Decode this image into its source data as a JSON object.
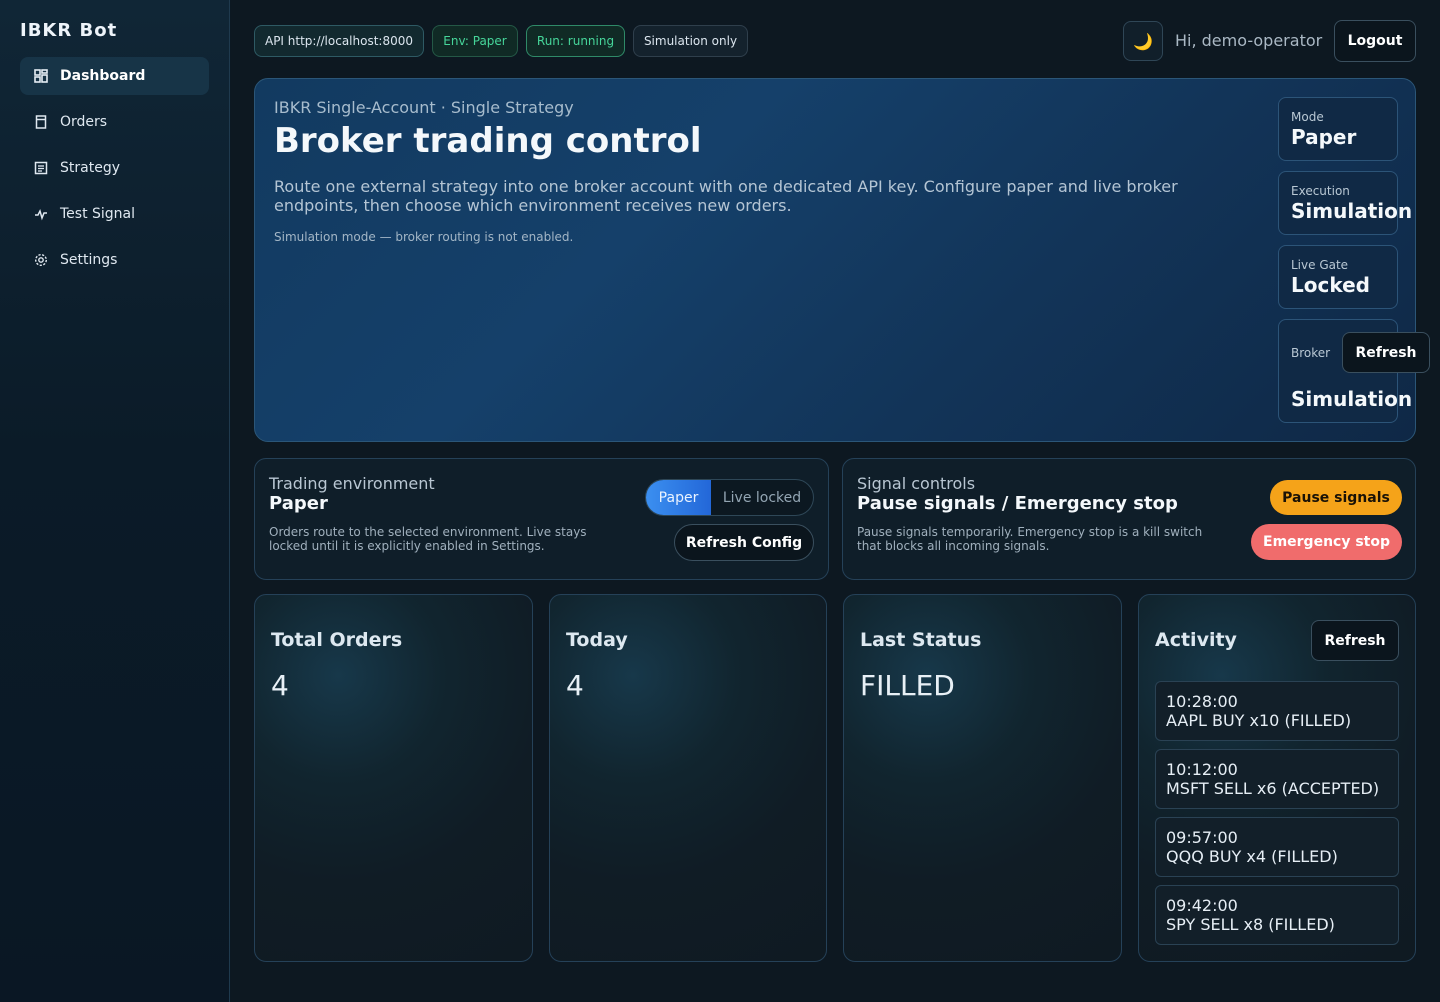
{
  "sidebar": {
    "brand": "IBKR Bot",
    "items": [
      {
        "label": "Dashboard",
        "icon": "dashboard-icon",
        "active": true
      },
      {
        "label": "Orders",
        "icon": "orders-icon"
      },
      {
        "label": "Strategy",
        "icon": "strategy-icon"
      },
      {
        "label": "Test Signal",
        "icon": "signal-icon"
      },
      {
        "label": "Settings",
        "icon": "gear-icon"
      }
    ]
  },
  "header": {
    "api_badge": "API http://localhost:8000",
    "env_badge": "Env: Paper",
    "run_badge": "Run: running",
    "sim_badge": "Simulation only",
    "theme_icon": "moon-icon",
    "greeting": "Hi, demo-operator",
    "logout_label": "Logout"
  },
  "hero": {
    "subtitle": "IBKR Single-Account · Single Strategy",
    "title": "Broker trading control",
    "description": "Route one external strategy into one broker account with one dedicated API key. Configure paper and live broker endpoints, then choose which environment receives new orders.",
    "note": "Simulation mode — broker routing is not enabled.",
    "stats": {
      "mode": {
        "label": "Mode",
        "value": "Paper"
      },
      "execution": {
        "label": "Execution",
        "value": "Simulation"
      },
      "live_gate": {
        "label": "Live Gate",
        "value": "Locked"
      },
      "broker": {
        "label": "Broker",
        "value": "Simulation",
        "refresh_label": "Refresh"
      }
    }
  },
  "trading_env": {
    "label": "Trading environment",
    "title": "Paper",
    "description": "Orders route to the selected environment. Live stays locked until it is explicitly enabled in Settings.",
    "option_paper": "Paper",
    "option_live": "Live locked",
    "refresh_label": "Refresh Config"
  },
  "signal_controls": {
    "label": "Signal controls",
    "title": "Pause signals / Emergency stop",
    "description": "Pause signals temporarily. Emergency stop is a kill switch that blocks all incoming signals.",
    "pause_label": "Pause signals",
    "stop_label": "Emergency stop"
  },
  "metrics": {
    "total_orders": {
      "title": "Total Orders",
      "value": "4"
    },
    "today": {
      "title": "Today",
      "value": "4"
    },
    "last_status": {
      "title": "Last Status",
      "value": "FILLED"
    }
  },
  "activity": {
    "title": "Activity",
    "refresh_label": "Refresh",
    "items": [
      {
        "time": "10:28:00",
        "text": "AAPL BUY x10 (FILLED)"
      },
      {
        "time": "10:12:00",
        "text": "MSFT SELL x6 (ACCEPTED)"
      },
      {
        "time": "09:57:00",
        "text": "QQQ BUY x4 (FILLED)"
      },
      {
        "time": "09:42:00",
        "text": "SPY SELL x8 (FILLED)"
      }
    ]
  },
  "colors": {
    "accent_blue": "#2f7be6",
    "success_green": "#46d59a",
    "warning_amber": "#f5a319",
    "danger_red": "#f06c6c"
  }
}
